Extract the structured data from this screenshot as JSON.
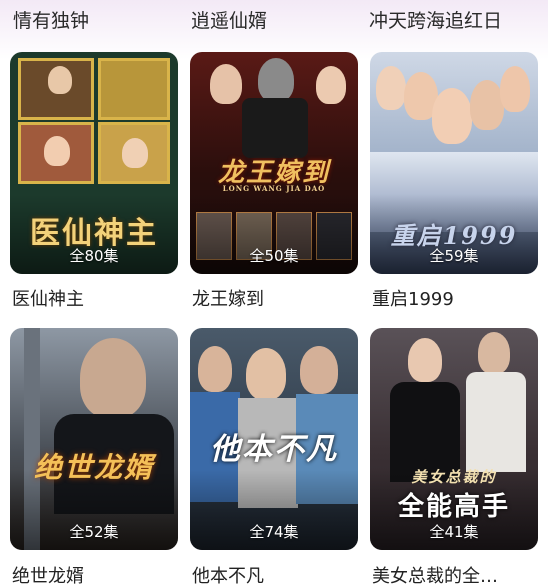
{
  "top_titles": [
    "情有独钟",
    "逍遥仙婿",
    "冲天跨海追红日"
  ],
  "dramas": [
    {
      "title": "医仙神主",
      "art_title": "医仙神主",
      "episodes": "全80集"
    },
    {
      "title": "龙王嫁到",
      "art_title": "龙王嫁到",
      "art_subtitle": "LONG WANG JIA DAO",
      "episodes": "全50集"
    },
    {
      "title": "重启1999",
      "art_title": "重启1999",
      "episodes": "全59集"
    },
    {
      "title": "绝世龙婿",
      "art_title": "绝世龙婿",
      "episodes": "全52集"
    },
    {
      "title": "他本不凡",
      "art_title": "他本不凡",
      "episodes": "全74集"
    },
    {
      "title": "美女总裁的全…",
      "art_title": "全能高手",
      "art_pretitle": "美女总裁的",
      "episodes": "全41集"
    }
  ]
}
